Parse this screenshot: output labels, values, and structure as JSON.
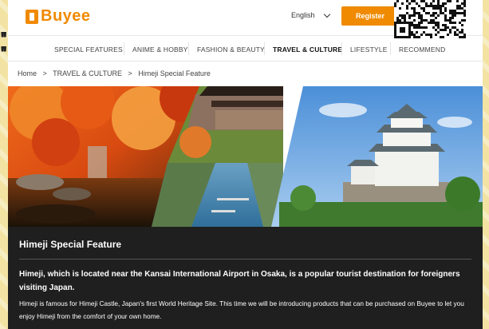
{
  "header": {
    "logo_text": "Buyee",
    "language": "English",
    "register_label": "Register"
  },
  "nav": {
    "items": [
      {
        "label": "SPECIAL FEATURES"
      },
      {
        "label": "ANIME & HOBBY"
      },
      {
        "label": "FASHION & BEAUTY"
      },
      {
        "label": "TRAVEL & CULTURE",
        "active": true
      },
      {
        "label": "LIFESTYLE"
      },
      {
        "label": "RECOMMEND"
      }
    ]
  },
  "breadcrumb": [
    "Home",
    ">",
    "TRAVEL & CULTURE",
    ">",
    "Himeji Special Feature"
  ],
  "article": {
    "title": "Himeji Special Feature",
    "lead": "Himeji, which is located near the Kansai International Airport in Osaka, is a popular tourist destination for foreigners visiting Japan.",
    "body": "Himeji is famous for Himeji Castle, Japan's first World Heritage Site. This time we will be introducing products that can be purchased on Buyee to let you enjoy Himeji from the comfort of your own home."
  },
  "colors": {
    "brand": "#f08a00",
    "content_bg": "#1f1f1f"
  }
}
